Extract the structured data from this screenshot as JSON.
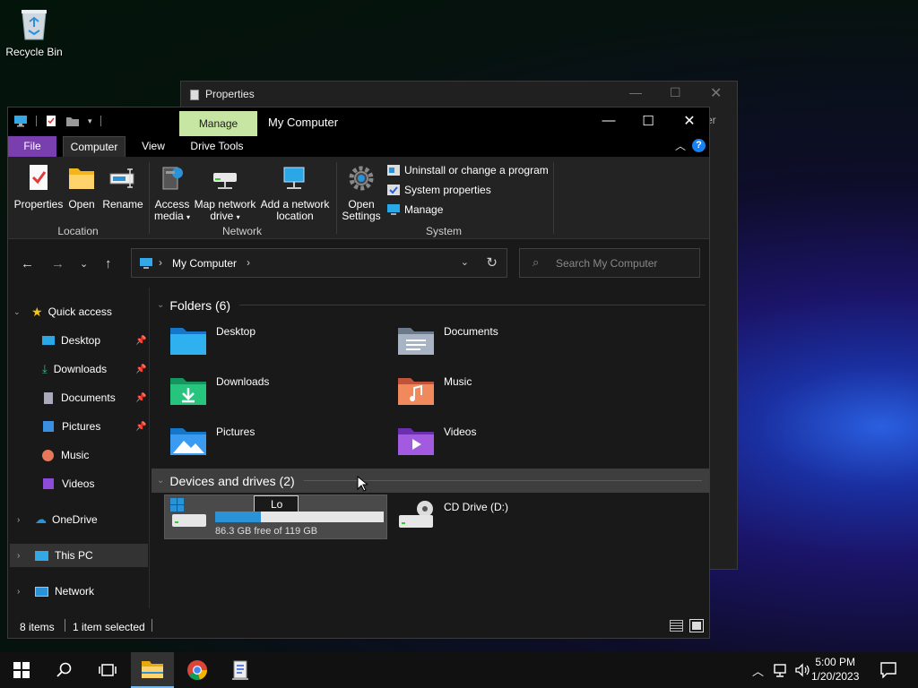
{
  "desktop": {
    "recycle_bin": "Recycle Bin"
  },
  "properties_window": {
    "title": "Properties",
    "clipped_text": "er"
  },
  "explorer": {
    "context_tab": "Manage",
    "title": "My Computer",
    "tabs": {
      "file": "File",
      "computer": "Computer",
      "view": "View",
      "drive_tools": "Drive Tools"
    },
    "help": "?",
    "ribbon": {
      "location": {
        "properties": "Properties",
        "open": "Open",
        "rename": "Rename",
        "group": "Location"
      },
      "network": {
        "access_media_1": "Access",
        "access_media_2": "media",
        "map_drive_1": "Map network",
        "map_drive_2": "drive",
        "add_location_1": "Add a network",
        "add_location_2": "location",
        "group": "Network"
      },
      "system": {
        "open_settings_1": "Open",
        "open_settings_2": "Settings",
        "uninstall": "Uninstall or change a program",
        "system_properties": "System properties",
        "manage": "Manage",
        "group": "System"
      }
    },
    "address": {
      "path": "My Computer"
    },
    "search": {
      "placeholder": "Search My Computer"
    },
    "nav": {
      "quick_access": "Quick access",
      "desktop": "Desktop",
      "downloads": "Downloads",
      "documents": "Documents",
      "pictures": "Pictures",
      "music": "Music",
      "videos": "Videos",
      "onedrive": "OneDrive",
      "this_pc": "This PC",
      "network": "Network"
    },
    "folders": {
      "header": "Folders (6)",
      "desktop": "Desktop",
      "documents": "Documents",
      "downloads": "Downloads",
      "music": "Music",
      "pictures": "Pictures",
      "videos": "Videos"
    },
    "drives": {
      "header": "Devices and drives (2)",
      "local_rename_value": "Lo",
      "local_free": "86.3 GB free of 119 GB",
      "local_used_fraction": 0.27,
      "cd_drive": "CD Drive (D:)"
    },
    "status": {
      "items": "8 items",
      "selected": "1 item selected"
    }
  },
  "taskbar": {
    "time": "5:00 PM",
    "date": "1/20/2023"
  },
  "colors": {
    "accent": "#1a7ff0",
    "file_tab": "#7a3faf",
    "manage_tab": "#c7e6a4",
    "drive_bar": "#2a93d8"
  }
}
